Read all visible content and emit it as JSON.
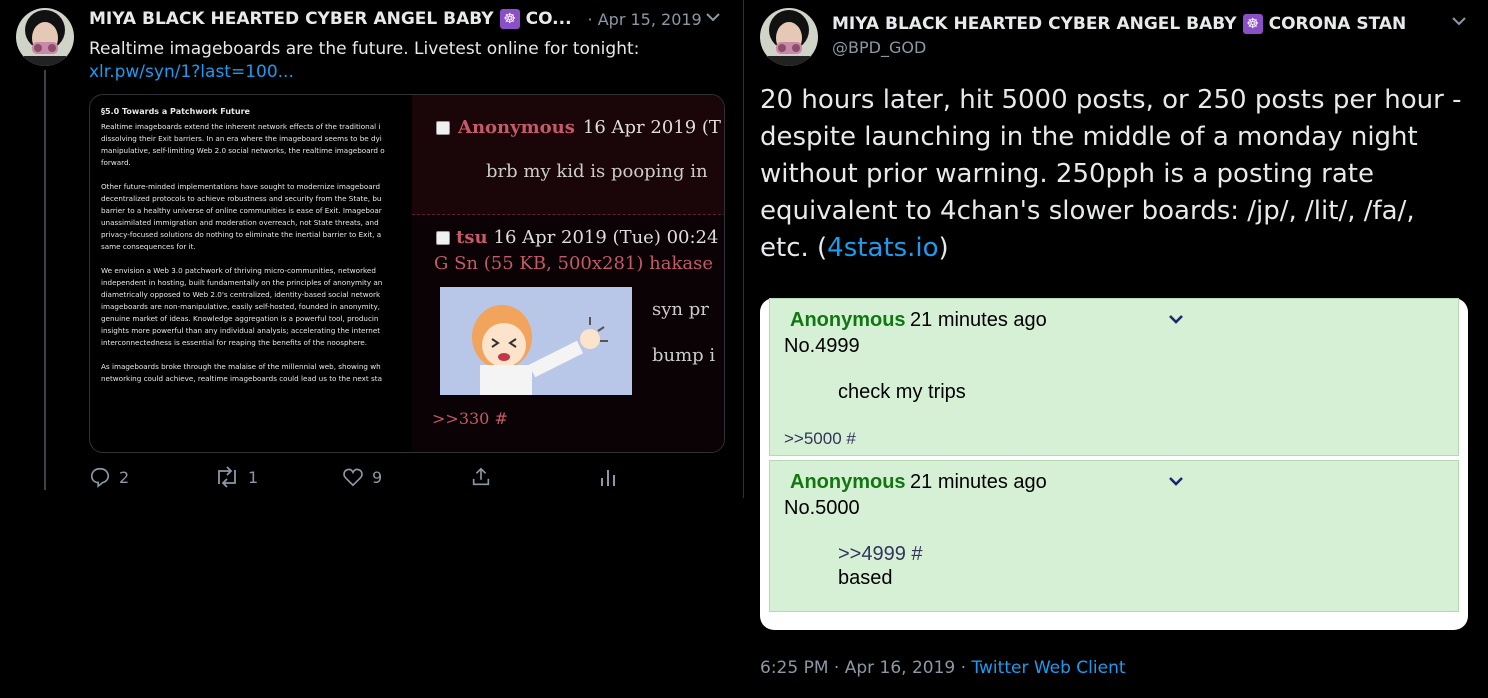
{
  "left_tweet": {
    "display_name": "MIYA BLACK HEARTED CYBER ANGEL BABY",
    "name_suffix": "CO...",
    "timestamp": "· Apr 15, 2019",
    "text": "Realtime imageboards are the future. Livetest online for tonight:",
    "link": "xlr.pw/syn/1?last=100...",
    "document": {
      "heading": "§5.0 Towards a Patchwork Future",
      "paragraphs": [
        [
          "Realtime imageboards extend the inherent network effects of the traditional i",
          "dissolving their Exit barriers. In an era where the imageboard seems to be dyi",
          "manipulative, self-limiting Web 2.0 social networks, the realtime imageboard o",
          "forward."
        ],
        [
          "Other future-minded implementations have sought to modernize imageboard",
          "decentralized protocols to achieve robustness and security from the State, bu",
          "barrier to a healthy universe of online communities is ease of Exit. Imageboar",
          "unassimilated immigration and moderation overreach, not State threats, and",
          "privacy-focused solutions do nothing to eliminate the inertial barrier to Exit, a",
          "same consequences for it."
        ],
        [
          "We envision a Web 3.0 patchwork of thriving micro-communities, networked",
          "independent in hosting, built fundamentally on the principles of anonymity an",
          "diametrically opposed to Web 2.0's centralized, identity-based social network",
          "imageboards are non-manipulative, easily self-hosted, founded in anonymity,",
          "genuine market of ideas. Knowledge aggregation is a powerful tool, producin",
          "insights more powerful than any individual analysis; accelerating the internet",
          "interconnectedness is essential for reaping the benefits of the noosphere."
        ],
        [
          "As imageboards broke through the malaise of the millennial web, showing wh",
          "networking could achieve, realtime imageboards could lead us to the next sta"
        ]
      ]
    },
    "board": {
      "post1_name": "Anonymous",
      "post1_date": "16 Apr 2019 (T",
      "post1_body": "brb my kid is pooping in",
      "post2_name": "tsu",
      "post2_date": "16 Apr 2019 (Tue) 00:24",
      "post2_file": "G Sn (55 KB, 500x281) hakase",
      "post2_line1": "syn pr",
      "post2_line2": "bump i",
      "post2_ref": ">>330 #"
    },
    "actions": {
      "replies": "2",
      "retweets": "1",
      "likes": "9"
    }
  },
  "right_tweet": {
    "display_name": "MIYA BLACK HEARTED CYBER ANGEL BABY",
    "name_suffix": "CORONA STAN",
    "handle": "@BPD_GOD",
    "text_main": "20 hours later, hit 5000 posts, or 250 posts per hour - despite launching in the middle of a monday night without prior warning. 250pph is a posting rate equivalent to 4chan's slower boards: /jp/, /lit/, /fa/, etc. (",
    "text_link": "4stats.io",
    "text_end": ")",
    "posts": [
      {
        "name": "Anonymous",
        "time": "21 minutes ago",
        "number": "No.4999",
        "body": "check my trips",
        "ref": ">>5000 #"
      },
      {
        "name": "Anonymous",
        "time": "21 minutes ago",
        "number": "No.5000",
        "quote": ">>4999 #",
        "body": "based"
      }
    ],
    "footer_time": "6:25 PM · Apr 16, 2019 ·",
    "footer_client": "Twitter Web Client"
  },
  "colors": {
    "link": "#1d9bf0",
    "anon_green": "#117711",
    "post_bg": "#d6f0d6",
    "board_name": "#c45a6a"
  },
  "icons": [
    "reply-icon",
    "retweet-icon",
    "like-icon",
    "share-icon",
    "analytics-icon",
    "chevron-down-icon",
    "wheel-emoji-icon",
    "checkbox-icon"
  ]
}
